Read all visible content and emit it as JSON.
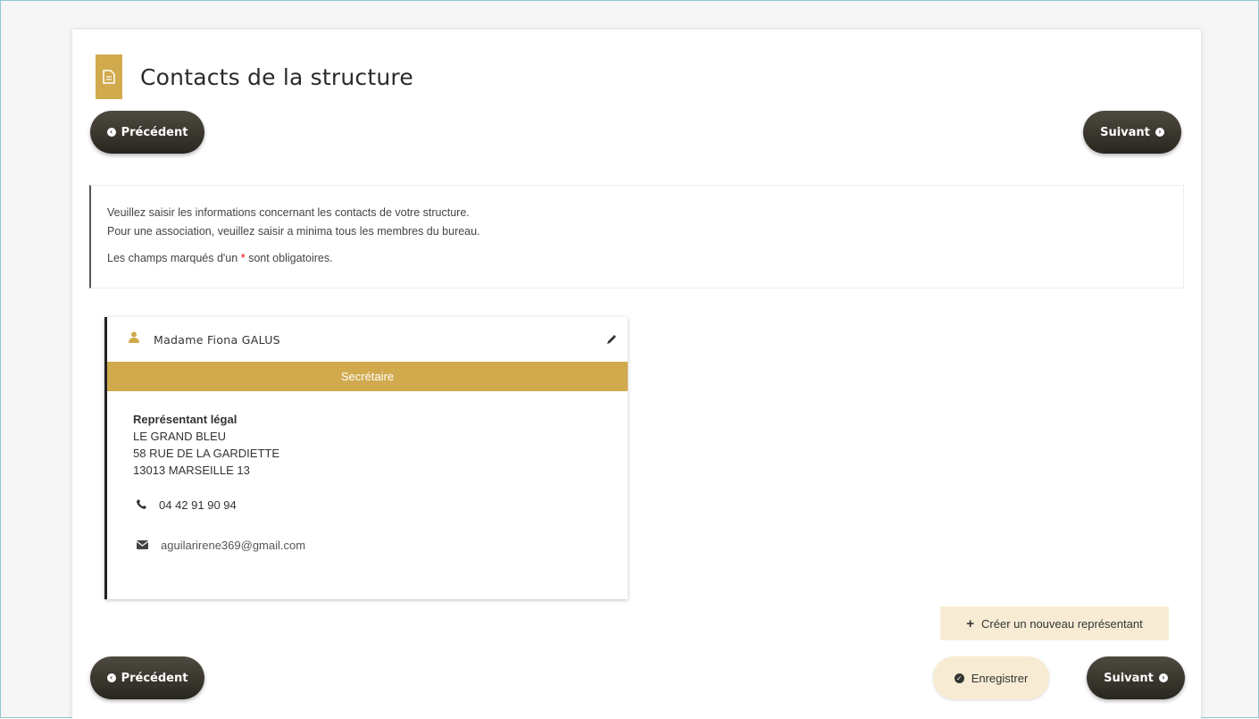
{
  "page": {
    "title": "Contacts de la structure",
    "icon": "document-icon"
  },
  "nav": {
    "prev_label": "Précédent",
    "next_label": "Suivant"
  },
  "info": {
    "line1": "Veuillez saisir les informations concernant les contacts de votre structure.",
    "line2": "Pour une association, veuillez saisir a minima tous les membres du bureau.",
    "required_prefix": "Les champs marqués d'un",
    "required_star": "*",
    "required_suffix": "sont obligatoires."
  },
  "contact": {
    "name": "Madame Fiona GALUS",
    "role": "Secrétaire",
    "type": "Représentant légal",
    "org": "LE GRAND BLEU",
    "street": "58 RUE DE LA GARDIETTE",
    "city": "13013 MARSEILLE 13",
    "phone": "04 42 91 90 94",
    "email": "aguilarirene369@gmail.com"
  },
  "actions": {
    "add_label": "Créer un nouveau représentant",
    "save_label": "Enregistrer"
  },
  "colors": {
    "accent": "#d1aa4e",
    "dark_button": "#2f2c25",
    "light_button": "#f7ecd3",
    "required": "#dd0000"
  }
}
